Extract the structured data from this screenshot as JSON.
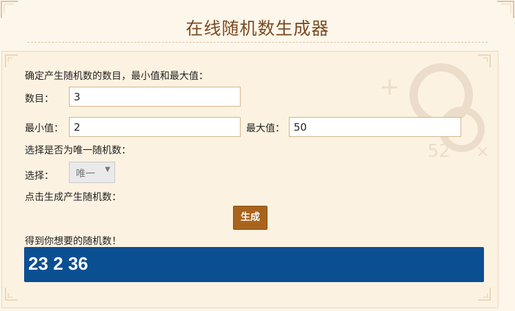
{
  "title": "在线随机数生成器",
  "form": {
    "intro": "确定产生随机数的数目，最小值和最大值：",
    "count_label": "数目：",
    "count_value": "3",
    "min_label": "最小值：",
    "min_value": "2",
    "max_label": "最大值：",
    "max_value": "50",
    "unique_prompt": "选择是否为唯一随机数：",
    "select_label": "选择：",
    "select_value": "唯一",
    "generate_prompt": "点击生成产生随机数：",
    "generate_button": "生成",
    "result_prompt": "得到你想要的随机数！",
    "result_value": "23 2 36"
  },
  "colors": {
    "accent": "#a8641c",
    "result_bg": "#0b4f93",
    "title": "#7a4a22",
    "panel_bg": "#fcf2e1"
  },
  "icons": {
    "select_arrow": "chevron-down-icon",
    "corner": "corner-ornament-icon"
  }
}
